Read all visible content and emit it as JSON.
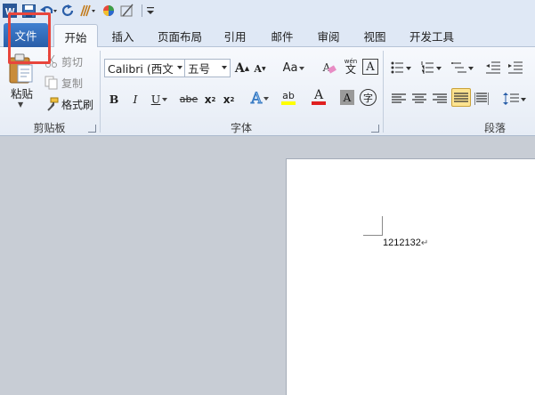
{
  "quick_access": {
    "word_icon_letter": "W",
    "customize_icon": "customize-qat-icon"
  },
  "tabs": [
    {
      "label": "文件"
    },
    {
      "label": "开始"
    },
    {
      "label": "插入"
    },
    {
      "label": "页面布局"
    },
    {
      "label": "引用"
    },
    {
      "label": "邮件"
    },
    {
      "label": "审阅"
    },
    {
      "label": "视图"
    },
    {
      "label": "开发工具"
    }
  ],
  "clipboard": {
    "group_label": "剪贴板",
    "paste": "粘贴",
    "cut": "剪切",
    "copy": "复制",
    "format_painter": "格式刷"
  },
  "font": {
    "group_label": "字体",
    "font_name": "Calibri (西文",
    "font_size": "五号",
    "grow": "A",
    "shrink": "A",
    "change_case": "Aa",
    "clear_format": "A",
    "phonetic_top": "wén",
    "phonetic_char": "文",
    "char_border": "A",
    "bold": "B",
    "italic": "I",
    "underline": "U",
    "strikethrough": "abe",
    "subscript": "x",
    "superscript": "x",
    "sub_mark": "2",
    "sup_mark": "2",
    "text_effects": "A",
    "highlight": "ab",
    "font_color": "A",
    "char_shading": "A",
    "enclose_char": "字",
    "highlight_color": "#ffff00",
    "font_color_value": "#e02020"
  },
  "paragraph": {
    "group_label": "段落"
  },
  "document": {
    "text": "1212132",
    "paragraph_mark": "↵"
  },
  "colors": {
    "file_tab": "#2a5ea8",
    "highlight_box": "#e8453c",
    "active_align": "#fde390"
  }
}
